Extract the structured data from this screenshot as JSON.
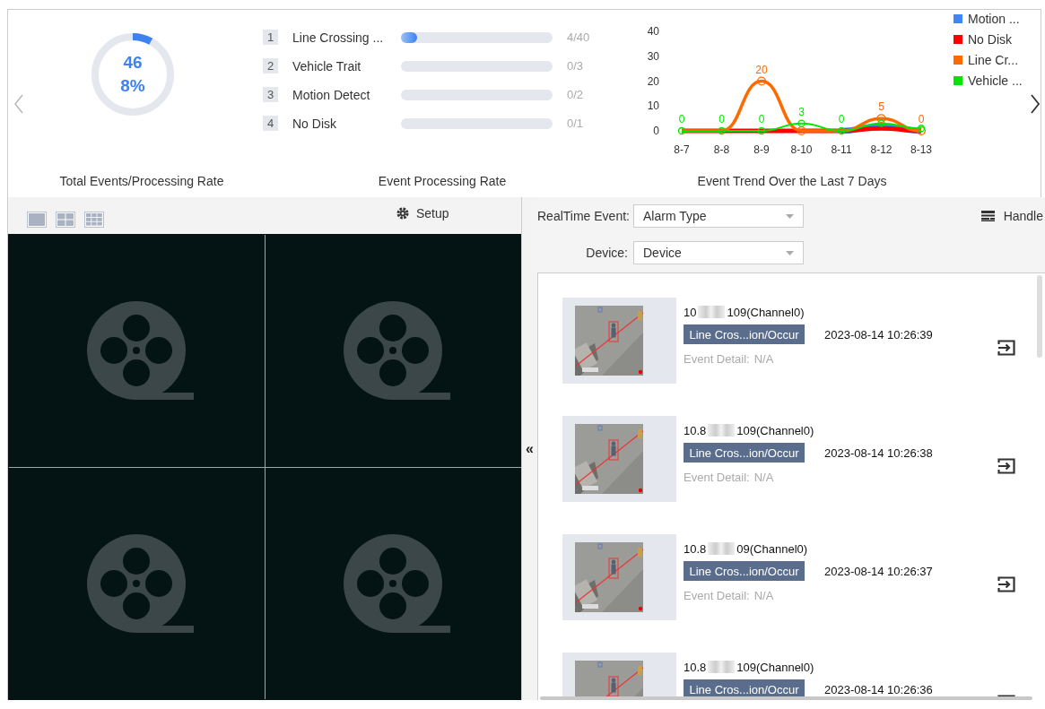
{
  "summary": {
    "total": "46",
    "rate": "8%",
    "level": 0.08,
    "caption": "Total Events/Processing Rate"
  },
  "processing": {
    "caption": "Event Processing Rate",
    "rows": [
      {
        "index": "1",
        "label": "Line Crossing ...",
        "level": 0.1,
        "reading": "4/40"
      },
      {
        "index": "2",
        "label": "Vehicle Trait",
        "level": 0,
        "reading": "0/3"
      },
      {
        "index": "3",
        "label": "Motion Detect",
        "level": 0,
        "reading": "0/2"
      },
      {
        "index": "4",
        "label": "No Disk",
        "level": 0,
        "reading": "0/1"
      }
    ]
  },
  "trend": {
    "caption": "Event Trend Over the Last 7 Days",
    "chart_data": {
      "type": "line",
      "categories": [
        "8-7",
        "8-8",
        "8-9",
        "8-10",
        "8-11",
        "8-12",
        "8-13"
      ],
      "ylim": [
        0,
        40
      ],
      "yticks": [
        0,
        10,
        20,
        30,
        40
      ],
      "series": [
        {
          "name": "Motion ...",
          "color": "#4285f4",
          "marker": "none",
          "values": [
            null,
            null,
            null,
            null,
            0,
            2,
            0
          ],
          "value_labels": [
            null,
            null,
            null,
            null,
            null,
            null,
            null
          ]
        },
        {
          "name": "No Disk",
          "color": "#ff0000",
          "marker": "none",
          "values": [
            0,
            0,
            0,
            0,
            0,
            1,
            0
          ],
          "value_labels": [
            null,
            null,
            null,
            null,
            null,
            null,
            null
          ]
        },
        {
          "name": "Line Cr...",
          "color": "#ff6a00",
          "marker": "circle",
          "values": [
            0,
            0,
            20,
            0,
            0,
            5,
            0
          ],
          "value_labels": [
            null,
            null,
            "20",
            null,
            null,
            "5",
            "0"
          ]
        },
        {
          "name": "Vehicle ...",
          "color": "#00e600",
          "marker": "circle",
          "values": [
            0,
            0,
            0,
            3,
            0,
            3,
            1
          ],
          "value_labels": [
            "0",
            "0",
            "0",
            "3",
            "0",
            null,
            null
          ]
        }
      ]
    }
  },
  "video": {
    "layouts": [
      {
        "kind": "single",
        "selected": false
      },
      {
        "kind": "quad",
        "selected": false
      },
      {
        "kind": "nine",
        "selected": false
      }
    ],
    "setup": "Setup",
    "collapse": "«"
  },
  "events": {
    "realtime_label": "RealTime Event:",
    "alarm_type": {
      "placeholder": "Alarm Type"
    },
    "device_label": "Device:",
    "device": {
      "placeholder": "Device"
    },
    "handle": "Handle",
    "items": [
      {
        "ip_start": "10",
        "ip_end": "109(Channel0)",
        "type": "Line Cros...ion/Occur",
        "time": "2023-08-14 10:26:39",
        "detail_label": "Event Detail:",
        "detail": "N/A"
      },
      {
        "ip_start": "10.8",
        "ip_end": "109(Channel0)",
        "type": "Line Cros...ion/Occur",
        "time": "2023-08-14 10:26:38",
        "detail_label": "Event Detail:",
        "detail": "N/A"
      },
      {
        "ip_start": "10.8",
        "ip_end": "09(Channel0)",
        "type": "Line Cros...ion/Occur",
        "time": "2023-08-14 10:26:37",
        "detail_label": "Event Detail:",
        "detail": "N/A"
      },
      {
        "ip_start": "10.8",
        "ip_end": "109(Channel0)",
        "type": "Line Cros...ion/Occur",
        "time": "2023-08-14 10:26:36"
      }
    ]
  }
}
